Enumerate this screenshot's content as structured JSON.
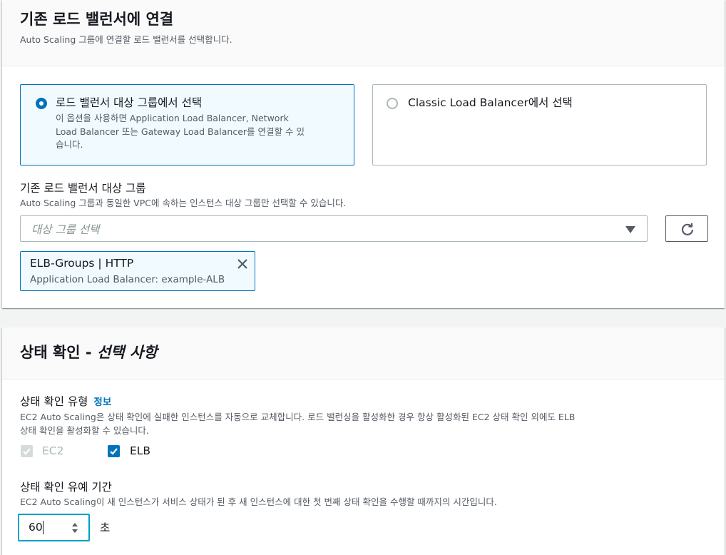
{
  "load_balancer_section": {
    "title": "기존 로드 밸런서에 연결",
    "description": "Auto Scaling 그룹에 연결할 로드 밸런서를 선택합니다.",
    "options": [
      {
        "title": "로드 밸런서 대상 그룹에서 선택",
        "description_line1": "이 옵션을 사용하면 Application Load Balancer, Network",
        "description_line2": "Load Balancer 또는 Gateway Load Balancer를 연결할 수 있",
        "description_line3": "습니다.",
        "selected": true
      },
      {
        "title": "Classic Load Balancer에서 선택",
        "selected": false
      }
    ],
    "target_group_label": "기존 로드 밸런서 대상 그룹",
    "target_group_description": "Auto Scaling 그룹과 동일한 VPC에 속하는 인스턴스 대상 그룹만 선택할 수 있습니다.",
    "select_placeholder": "대상 그룹 선택",
    "selected_token": {
      "title": "ELB-Groups | HTTP",
      "subtitle": "Application Load Balancer: example-ALB"
    }
  },
  "health_check_section": {
    "title_main": "상태 확인 - ",
    "title_optional": "선택 사항",
    "type_label": "상태 확인 유형",
    "info_link": "정보",
    "type_description_line1": "EC2 Auto Scaling은 상태 확인에 실패한 인스턴스를 자동으로 교체합니다. 로드 밸런싱을 활성화한 경우 항상 활성화된 EC2 상태 확인 외에도 ELB",
    "type_description_line2": "상태 확인을 활성화할 수 있습니다.",
    "checkboxes": [
      {
        "label": "EC2",
        "checked": true,
        "disabled": true
      },
      {
        "label": "ELB",
        "checked": true,
        "disabled": false
      }
    ],
    "grace_label": "상태 확인 유예 기간",
    "grace_description": "EC2 Auto Scaling이 새 인스턴스가 서비스 상태가 된 후 새 인스턴스에 대한 첫 번째 상태 확인을 수행할 때까지의 시간입니다.",
    "grace_value": "60",
    "grace_unit": "초"
  },
  "colors": {
    "accent": "#0073bb",
    "focus": "#00a1c9",
    "selected_bg": "#f1faff",
    "disabled": "#d5dbdb"
  },
  "icons": {
    "refresh": "refresh-icon",
    "close": "close-icon",
    "caret": "caret-down-icon"
  }
}
